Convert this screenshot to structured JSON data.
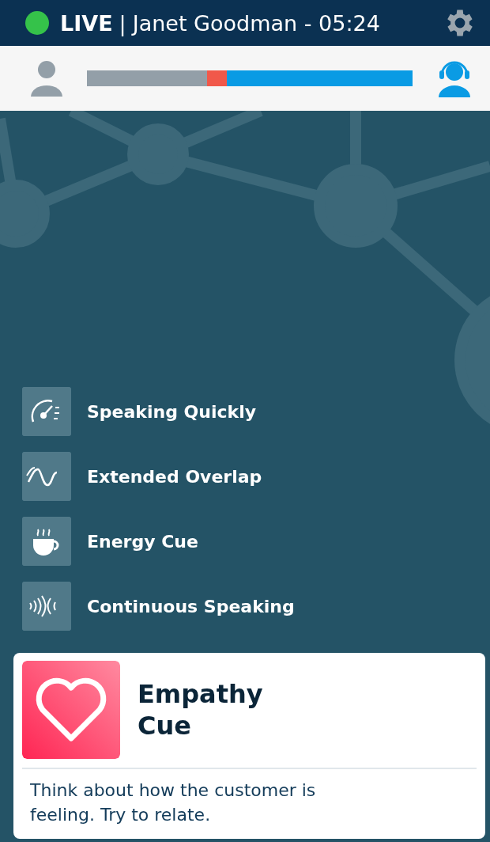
{
  "header": {
    "live": true,
    "status": "LIVE",
    "divider": "|",
    "title": "Janet Goodman - 05:24"
  },
  "talk_ratio": {
    "segments": [
      {
        "kind": "customer",
        "color": "#939fa8"
      },
      {
        "kind": "overlap",
        "color": "#f1584a"
      },
      {
        "kind": "agent",
        "color": "#0a9be4"
      }
    ]
  },
  "cues": [
    {
      "kind": "speed",
      "label": "Speaking Quickly"
    },
    {
      "kind": "wave",
      "label": "Extended Overlap"
    },
    {
      "kind": "coffee",
      "label": "Energy Cue"
    },
    {
      "kind": "sound",
      "label": "Continuous Speaking"
    }
  ],
  "card": {
    "kind": "heart",
    "title": "Empathy Cue",
    "message": "Think about how the customer is feeling. Try to relate."
  }
}
